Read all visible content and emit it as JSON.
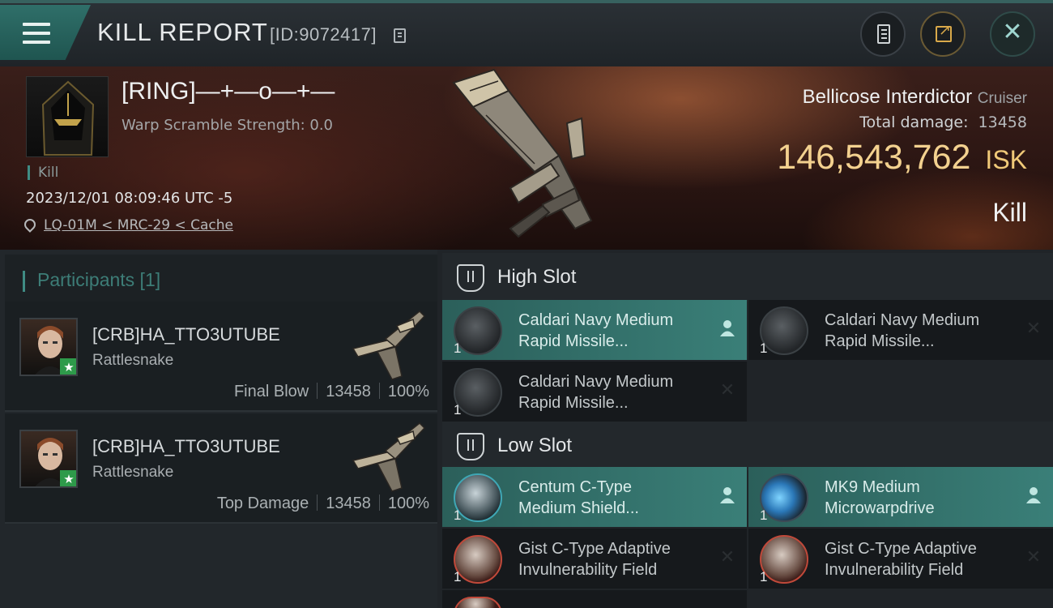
{
  "header": {
    "title": "KILL REPORT",
    "report_id": "[ID:9072417]"
  },
  "victim": {
    "name": "[RING]—+—o—+—",
    "warp_scramble": "Warp Scramble Strength: 0.0",
    "tag": "Kill",
    "timestamp": "2023/12/01 08:09:46 UTC -5",
    "location": "LQ-01M < MRC-29 < Cache",
    "ship_name": "Bellicose Interdictor",
    "ship_class": "Cruiser",
    "total_damage_label": "Total damage:",
    "total_damage": "13458",
    "isk_value": "146,543,762",
    "isk_unit": "ISK",
    "result": "Kill"
  },
  "participants": {
    "label": "Participants [1]",
    "items": [
      {
        "name": "[CRB]HA_TTO3UTUBE",
        "ship": "Rattlesnake",
        "role": "Final Blow",
        "damage": "13458",
        "percent": "100%"
      },
      {
        "name": "[CRB]HA_TTO3UTUBE",
        "ship": "Rattlesnake",
        "role": "Top Damage",
        "damage": "13458",
        "percent": "100%"
      }
    ]
  },
  "slots": {
    "high": {
      "label": "High Slot",
      "modules": [
        {
          "line1": "Caldari Navy Medium",
          "line2": "Rapid Missile...",
          "qty": "1",
          "state": "dropped",
          "icon": "missile-launcher-icon"
        },
        {
          "line1": "Caldari Navy Medium",
          "line2": "Rapid Missile...",
          "qty": "1",
          "state": "destroyed",
          "icon": "missile-launcher-icon"
        },
        {
          "line1": "Caldari Navy Medium",
          "line2": "Rapid Missile...",
          "qty": "1",
          "state": "destroyed",
          "icon": "missile-launcher-icon"
        }
      ]
    },
    "low": {
      "label": "Low Slot",
      "modules": [
        {
          "line1": "Centum C-Type",
          "line2": "Medium Shield...",
          "qty": "1",
          "state": "dropped",
          "icon": "shield-icon"
        },
        {
          "line1": "MK9 Medium",
          "line2": "Microwarpdrive",
          "qty": "1",
          "state": "dropped",
          "icon": "microwarpdrive-icon"
        },
        {
          "line1": "Gist C-Type Adaptive",
          "line2": "Invulnerability Field",
          "qty": "1",
          "state": "destroyed",
          "icon": "shield-icon"
        },
        {
          "line1": "Gist C-Type Adaptive",
          "line2": "Invulnerability Field",
          "qty": "1",
          "state": "destroyed",
          "icon": "shield-icon"
        }
      ]
    }
  },
  "colors": {
    "accent_teal": "#3a7f78",
    "isk_gold": "#f3d18f"
  }
}
